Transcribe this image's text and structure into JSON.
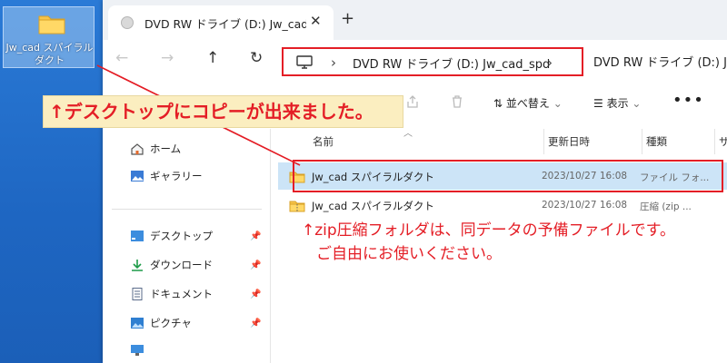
{
  "desktop": {
    "icon_label": "Jw_cad スパイラルダクト"
  },
  "window": {
    "tab": {
      "title": "DVD RW ドライブ (D:) Jw_cad_spd",
      "close": "✕"
    },
    "new_tab": "+",
    "nav": {
      "back": "←",
      "forward": "→",
      "up": "↑",
      "refresh": "↻"
    },
    "address": {
      "sep": "›",
      "path": "DVD RW ドライブ (D:) Jw_cad_spd",
      "trailing_sep": "›",
      "overflow_text": "DVD RW ドライブ (D:) Jw_ca"
    },
    "toolbar": {
      "sort_label": "並べ替え",
      "view_label": "表示",
      "more": "•••",
      "chevron": "⌄"
    },
    "sidebar": {
      "items": [
        {
          "label": "ホーム",
          "icon": "home-icon"
        },
        {
          "label": "ギャラリー",
          "icon": "gallery-icon"
        },
        {
          "label": "デスクトップ",
          "icon": "desktop-icon"
        },
        {
          "label": "ダウンロード",
          "icon": "download-icon"
        },
        {
          "label": "ドキュメント",
          "icon": "document-icon"
        },
        {
          "label": "ピクチャ",
          "icon": "picture-icon"
        },
        {
          "label": "",
          "icon": "monitor-icon"
        }
      ],
      "pin": "📌"
    },
    "columns": {
      "name": "名前",
      "modified": "更新日時",
      "type": "種類",
      "size": "サ"
    },
    "files": [
      {
        "name": "Jw_cad スパイラルダクト",
        "modified": "2023/10/27 16:08",
        "type": "ファイル フォ..."
      },
      {
        "name": "Jw_cad スパイラルダクト",
        "modified": "2023/10/27 16:08",
        "type": "圧縮 (zip ..."
      }
    ]
  },
  "annotations": {
    "callout": "↑デスクトップにコピーが出来ました。",
    "note_line1": "↑zip圧縮フォルダは、同データの予備ファイルです。",
    "note_line2": "ご自由にお使いください。"
  },
  "colors": {
    "accent_red": "#e41e26",
    "selection": "#cce4f7",
    "callout_bg": "#fbeec0",
    "desktop_blue": "#1f6ec8"
  }
}
